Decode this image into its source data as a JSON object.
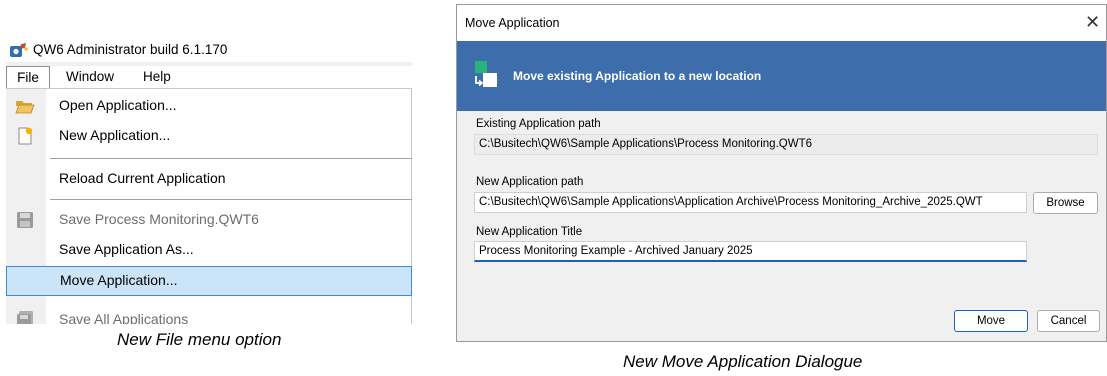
{
  "menu_screenshot": {
    "window_title": "QW6 Administrator build 6.1.170",
    "menubar": {
      "file": "File",
      "window": "Window",
      "help": "Help"
    },
    "items": [
      {
        "label": "Open Application...",
        "icon": "folder-open-icon",
        "enabled": true
      },
      {
        "label": "New Application...",
        "icon": "new-document-icon",
        "enabled": true
      },
      {
        "label": "Reload Current Application",
        "enabled": true
      },
      {
        "label": "Save Process Monitoring.QWT6",
        "icon": "save-icon",
        "enabled": false
      },
      {
        "label": "Save Application As...",
        "enabled": true
      },
      {
        "label": "Move Application...",
        "enabled": true,
        "highlighted": true
      },
      {
        "label": "Save All Applications",
        "icon": "save-all-icon",
        "enabled": false
      }
    ],
    "caption": "New File menu option"
  },
  "dialog": {
    "title": "Move Application",
    "close_glyph": "✕",
    "banner_text": "Move existing Application to a new location",
    "existing_path_label": "Existing Application path",
    "existing_path_value": "C:\\Busitech\\QW6\\Sample Applications\\Process Monitoring.QWT6",
    "new_path_label": "New Application path",
    "new_path_value": "C:\\Busitech\\QW6\\Sample Applications\\Application Archive\\Process Monitoring_Archive_2025.QWT",
    "browse_label": "Browse",
    "new_title_label": "New Application Title",
    "new_title_value": "Process Monitoring Example - Archived January 2025",
    "move_label": "Move",
    "cancel_label": "Cancel",
    "caption": "New Move Application Dialogue"
  },
  "colors": {
    "banner": "#3d6dab",
    "menu_highlight": "#cce4f7",
    "menu_highlight_border": "#3e8ad6"
  }
}
